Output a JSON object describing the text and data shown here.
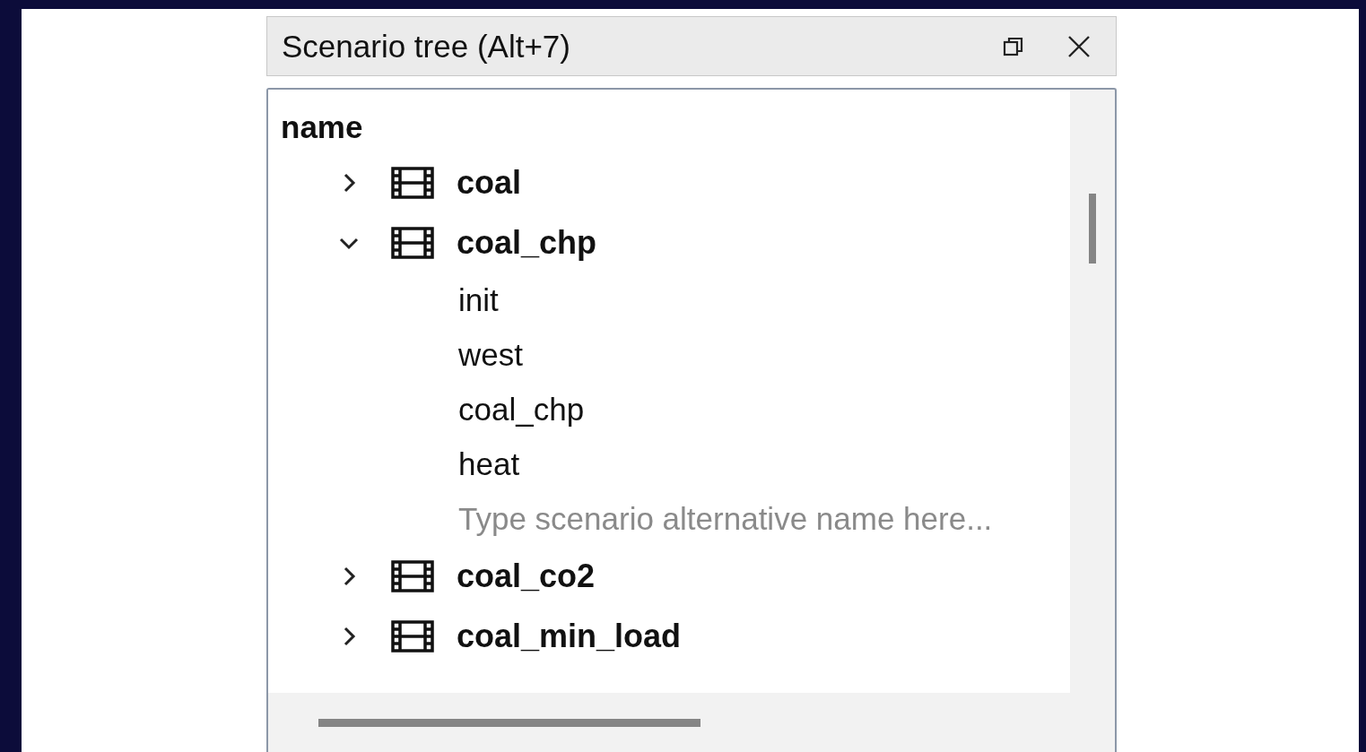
{
  "panel": {
    "title": "Scenario tree (Alt+7)"
  },
  "tree": {
    "column_header": "name",
    "items": [
      {
        "kind": "scenario",
        "label": "coal",
        "expanded": false
      },
      {
        "kind": "scenario",
        "label": "coal_chp",
        "expanded": true,
        "children": [
          {
            "kind": "alternative",
            "label": "init"
          },
          {
            "kind": "alternative",
            "label": "west"
          },
          {
            "kind": "alternative",
            "label": "coal_chp"
          },
          {
            "kind": "alternative",
            "label": "heat"
          },
          {
            "kind": "placeholder",
            "placeholder": "Type scenario alternative name here..."
          }
        ]
      },
      {
        "kind": "scenario",
        "label": "coal_co2",
        "expanded": false
      },
      {
        "kind": "scenario",
        "label": "coal_min_load",
        "expanded": false
      }
    ]
  }
}
